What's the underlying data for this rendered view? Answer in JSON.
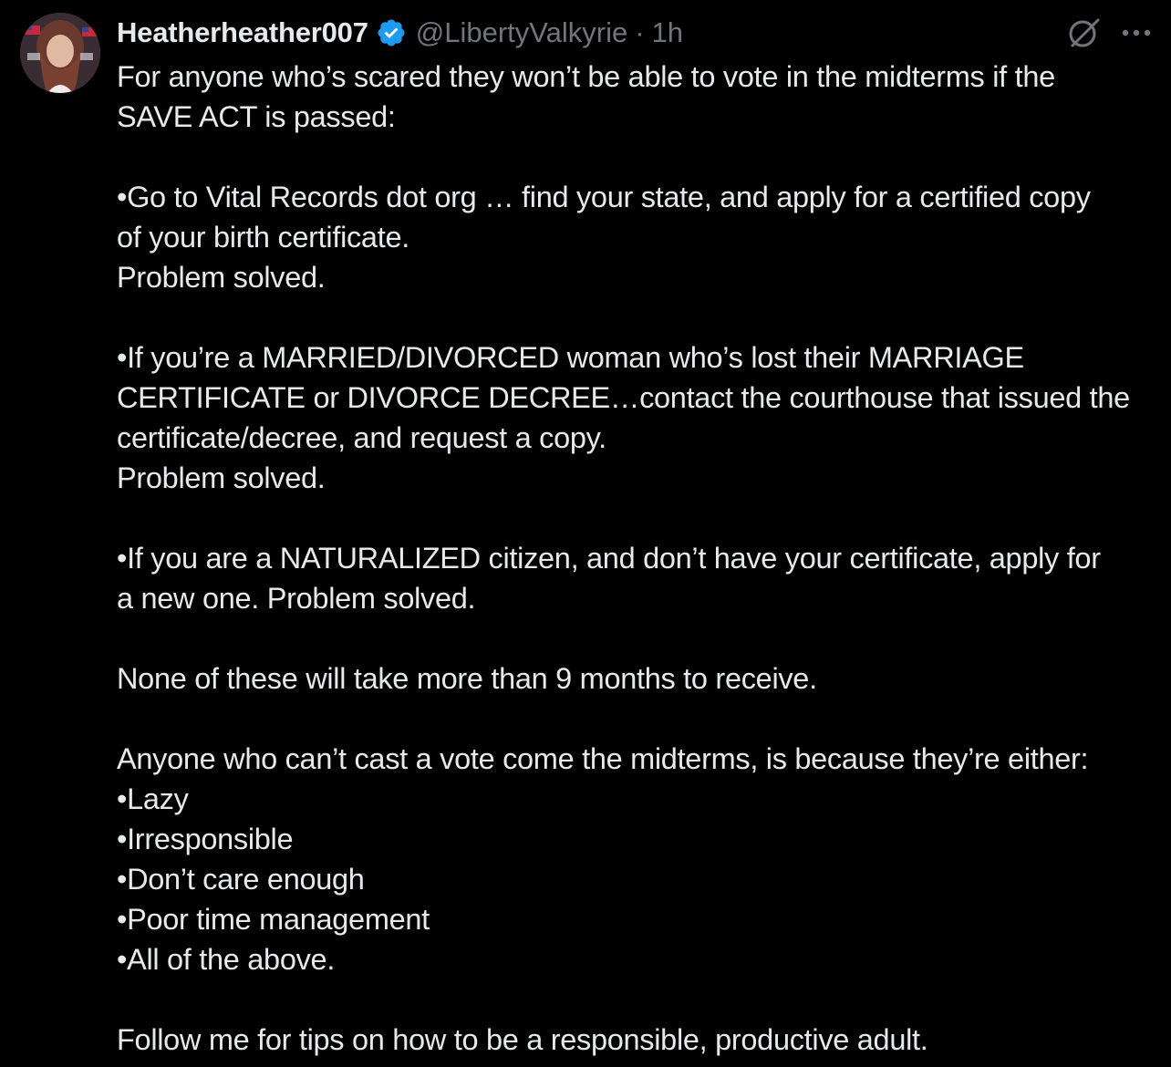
{
  "tweet": {
    "display_name": "Heatherheather007",
    "handle": "@LibertyValkyrie",
    "separator": "·",
    "time": "1h",
    "verified": true,
    "accent_color": "#1d9bf0",
    "icons": [
      "verified-badge-icon",
      "grok-icon",
      "more-options-icon"
    ],
    "paragraphs": [
      [
        "For anyone who’s scared they won’t be able to vote in the midterms if the",
        "SAVE ACT is passed:"
      ],
      [
        "•Go to Vital Records dot org … find your state, and apply for a certified copy",
        "of your birth certificate.",
        "Problem solved."
      ],
      [
        "•If you’re a MARRIED/DIVORCED woman who’s lost their MARRIAGE",
        "CERTIFICATE or DIVORCE DECREE…contact the courthouse that issued the",
        "certificate/decree, and request a copy.",
        "Problem solved."
      ],
      [
        "•If you are a NATURALIZED citizen, and don’t have your certificate, apply for",
        "a new one.  Problem solved."
      ],
      [
        "None of these will take more than 9 months to receive."
      ],
      [
        "Anyone who can’t cast a vote come the midterms, is because they’re either:",
        "•Lazy",
        "•Irresponsible",
        "•Don’t care enough",
        "•Poor time management",
        "•All of the above."
      ],
      [
        "Follow me for tips on how to be a responsible, productive adult."
      ]
    ]
  }
}
